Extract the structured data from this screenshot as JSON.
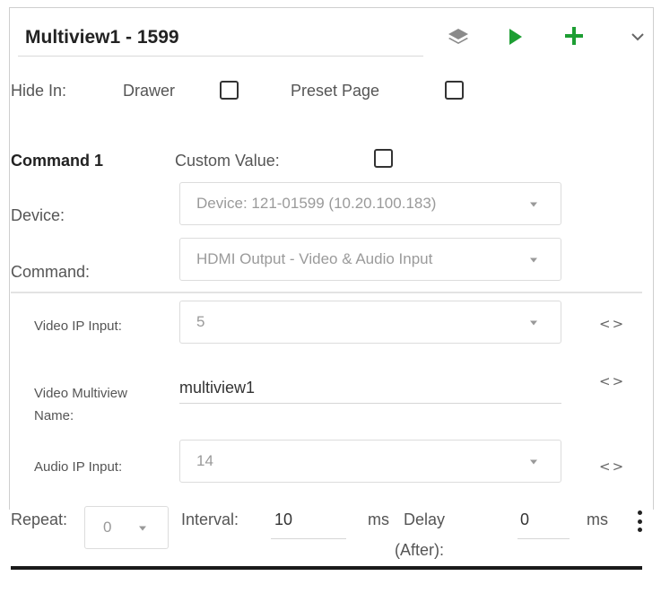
{
  "header": {
    "title": "Multiview1 - 1599",
    "icons": [
      "layers-icon",
      "play-icon",
      "plus-icon",
      "chevron-down-icon"
    ],
    "play_color": "#1d9e33",
    "plus_color": "#1d9e33"
  },
  "hide_in": {
    "label": "Hide In:",
    "drawer_label": "Drawer",
    "drawer_checked": false,
    "preset_label": "Preset Page",
    "preset_checked": false
  },
  "command": {
    "title": "Command 1",
    "custom_value_label": "Custom Value:",
    "custom_value_checked": false,
    "device_label": "Device:",
    "device_value": "Device: 121-01599 (10.20.100.183)",
    "command_label": "Command:",
    "command_value": "HDMI Output - Video & Audio Input"
  },
  "params": {
    "video_ip_label": "Video IP Input:",
    "video_ip_value": "5",
    "multiview_label_line1": "Video Multiview",
    "multiview_label_line2": "Name:",
    "multiview_value": "multiview1",
    "audio_ip_label": "Audio IP Input:",
    "audio_ip_value": "14",
    "code_icon_glyph": "<>"
  },
  "timing": {
    "repeat_label": "Repeat:",
    "repeat_value": "0",
    "interval_label": "Interval:",
    "interval_value": "10",
    "interval_unit": "ms",
    "delay_label_line1": "Delay",
    "delay_label_line2": "(After):",
    "delay_value": "0",
    "delay_unit": "ms"
  }
}
